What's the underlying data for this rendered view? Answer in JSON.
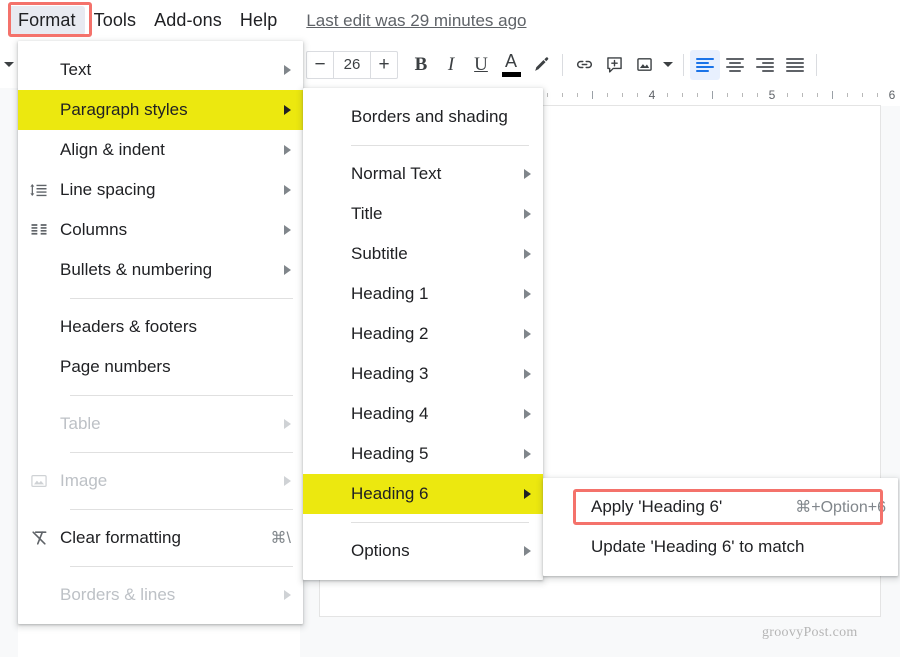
{
  "menubar": {
    "items": [
      {
        "label": "Format",
        "active": true
      },
      {
        "label": "Tools",
        "active": false
      },
      {
        "label": "Add-ons",
        "active": false
      },
      {
        "label": "Help",
        "active": false
      }
    ],
    "last_edit": "Last edit was 29 minutes ago"
  },
  "toolbar": {
    "font_size": "26",
    "decrease_label": "−",
    "increase_label": "+",
    "bold_label": "B",
    "italic_label": "I",
    "underline_label": "U",
    "text_color_label": "A",
    "highlight_icon": "highlighter-pen-icon",
    "link_icon": "link-icon",
    "comment_icon": "add-comment-icon",
    "image_icon": "insert-image-icon",
    "image_dropdown_icon": "chevron-down-icon",
    "align_left_icon": "align-left-icon",
    "align_center_icon": "align-center-icon",
    "align_right_icon": "align-right-icon",
    "align_justify_icon": "align-justify-icon",
    "active_alignment": "left",
    "active_color": "#1a73e8"
  },
  "ruler": {
    "numbers": [
      "4",
      "5",
      "6"
    ]
  },
  "format_menu": {
    "items": [
      {
        "label": "Text",
        "icon": null,
        "arrow": true,
        "disabled": false,
        "highlight": false,
        "accel": ""
      },
      {
        "label": "Paragraph styles",
        "icon": null,
        "arrow": true,
        "disabled": false,
        "highlight": true,
        "accel": ""
      },
      {
        "label": "Align & indent",
        "icon": null,
        "arrow": true,
        "disabled": false,
        "highlight": false,
        "accel": ""
      },
      {
        "label": "Line spacing",
        "icon": "line-spacing-icon",
        "arrow": true,
        "disabled": false,
        "highlight": false,
        "accel": ""
      },
      {
        "label": "Columns",
        "icon": "columns-icon",
        "arrow": true,
        "disabled": false,
        "highlight": false,
        "accel": ""
      },
      {
        "label": "Bullets & numbering",
        "icon": null,
        "arrow": true,
        "disabled": false,
        "highlight": false,
        "accel": ""
      },
      {
        "separator": true
      },
      {
        "label": "Headers & footers",
        "icon": null,
        "arrow": false,
        "disabled": false,
        "highlight": false,
        "accel": ""
      },
      {
        "label": "Page numbers",
        "icon": null,
        "arrow": false,
        "disabled": false,
        "highlight": false,
        "accel": ""
      },
      {
        "separator": true
      },
      {
        "label": "Table",
        "icon": null,
        "arrow": true,
        "disabled": true,
        "highlight": false,
        "accel": ""
      },
      {
        "separator": true
      },
      {
        "label": "Image",
        "icon": "image-icon",
        "arrow": true,
        "disabled": true,
        "highlight": false,
        "accel": ""
      },
      {
        "separator": true
      },
      {
        "label": "Clear formatting",
        "icon": "clear-formatting-icon",
        "arrow": false,
        "disabled": false,
        "highlight": false,
        "accel": "⌘\\"
      },
      {
        "separator": true
      },
      {
        "label": "Borders & lines",
        "icon": null,
        "arrow": true,
        "disabled": true,
        "highlight": false,
        "accel": ""
      }
    ]
  },
  "paragraph_styles_menu": {
    "items": [
      {
        "label": "Borders and shading",
        "arrow": false,
        "highlight": false
      },
      {
        "separator": true
      },
      {
        "label": "Normal Text",
        "arrow": true,
        "highlight": false
      },
      {
        "label": "Title",
        "arrow": true,
        "highlight": false
      },
      {
        "label": "Subtitle",
        "arrow": true,
        "highlight": false
      },
      {
        "label": "Heading 1",
        "arrow": true,
        "highlight": false
      },
      {
        "label": "Heading 2",
        "arrow": true,
        "highlight": false
      },
      {
        "label": "Heading 3",
        "arrow": true,
        "highlight": false
      },
      {
        "label": "Heading 4",
        "arrow": true,
        "highlight": false
      },
      {
        "label": "Heading 5",
        "arrow": true,
        "highlight": false
      },
      {
        "label": "Heading 6",
        "arrow": true,
        "highlight": true
      },
      {
        "separator": true
      },
      {
        "label": "Options",
        "arrow": true,
        "highlight": false
      }
    ]
  },
  "heading6_menu": {
    "items": [
      {
        "label": "Apply 'Heading 6'",
        "accel": "⌘+Option+6",
        "annotated": true
      },
      {
        "label": "Update 'Heading 6' to match",
        "accel": "",
        "annotated": false
      }
    ]
  },
  "watermark": {
    "text": "groovyPost.com"
  },
  "annotation": {
    "color": "#f4726b"
  }
}
